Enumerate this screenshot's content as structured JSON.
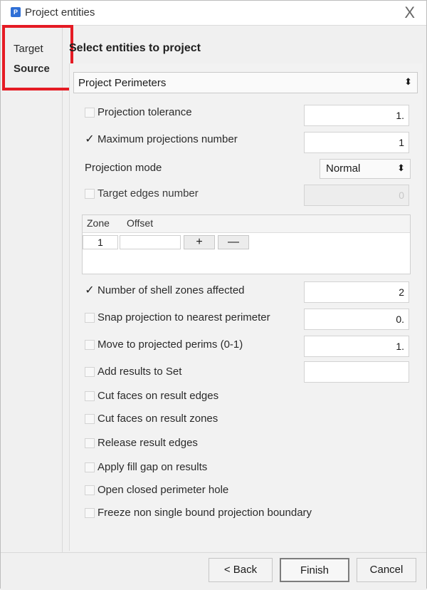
{
  "window": {
    "title": "Project entities",
    "close_symbol": "X",
    "nav": [
      {
        "label": "Target"
      },
      {
        "label": "Source"
      }
    ],
    "section_title": "Select entities to project",
    "main_dropdown": {
      "value": "Project Perimeters",
      "arrow": "⬍"
    },
    "rows": {
      "projection_tolerance": {
        "label": "Projection tolerance",
        "value": "1.",
        "checked": false
      },
      "max_projections": {
        "label": "Maximum projections number",
        "value": "1",
        "checked": true
      },
      "projection_mode": {
        "label": "Projection mode",
        "value": "Normal"
      },
      "target_edges": {
        "label": "Target edges number",
        "value": "0",
        "checked": false
      },
      "shell_zones": {
        "label": "Number of shell zones affected",
        "value": "2",
        "checked": true
      },
      "snap_projection": {
        "label": "Snap projection to nearest perimeter",
        "value": "0.",
        "checked": false
      },
      "move_projected": {
        "label": "Move to projected perims (0-1)",
        "value": "1.",
        "checked": false
      },
      "add_results": {
        "label": "Add results to Set",
        "value": "",
        "checked": false
      },
      "cut_edges": {
        "label": "Cut faces on result edges",
        "checked": false
      },
      "cut_zones": {
        "label": "Cut faces on result zones",
        "checked": false
      },
      "release_edges": {
        "label": "Release result edges",
        "checked": false
      },
      "fill_gap": {
        "label": "Apply fill gap on results",
        "checked": false
      },
      "open_hole": {
        "label": "Open closed perimeter hole",
        "checked": false
      },
      "freeze_boundary": {
        "label": "Freeze non single bound projection boundary",
        "checked": false
      }
    },
    "zone_table": {
      "headers": [
        "Zone",
        "Offset"
      ],
      "row": {
        "zone": "1",
        "offset": ""
      },
      "add_symbol": "+",
      "remove_symbol": "—"
    },
    "buttons": {
      "back": "< Back",
      "finish": "Finish",
      "cancel": "Cancel"
    },
    "check_symbol": "✓",
    "colors": {
      "highlight_border": "#e51b24",
      "app_icon": "#2f6fd6"
    }
  }
}
